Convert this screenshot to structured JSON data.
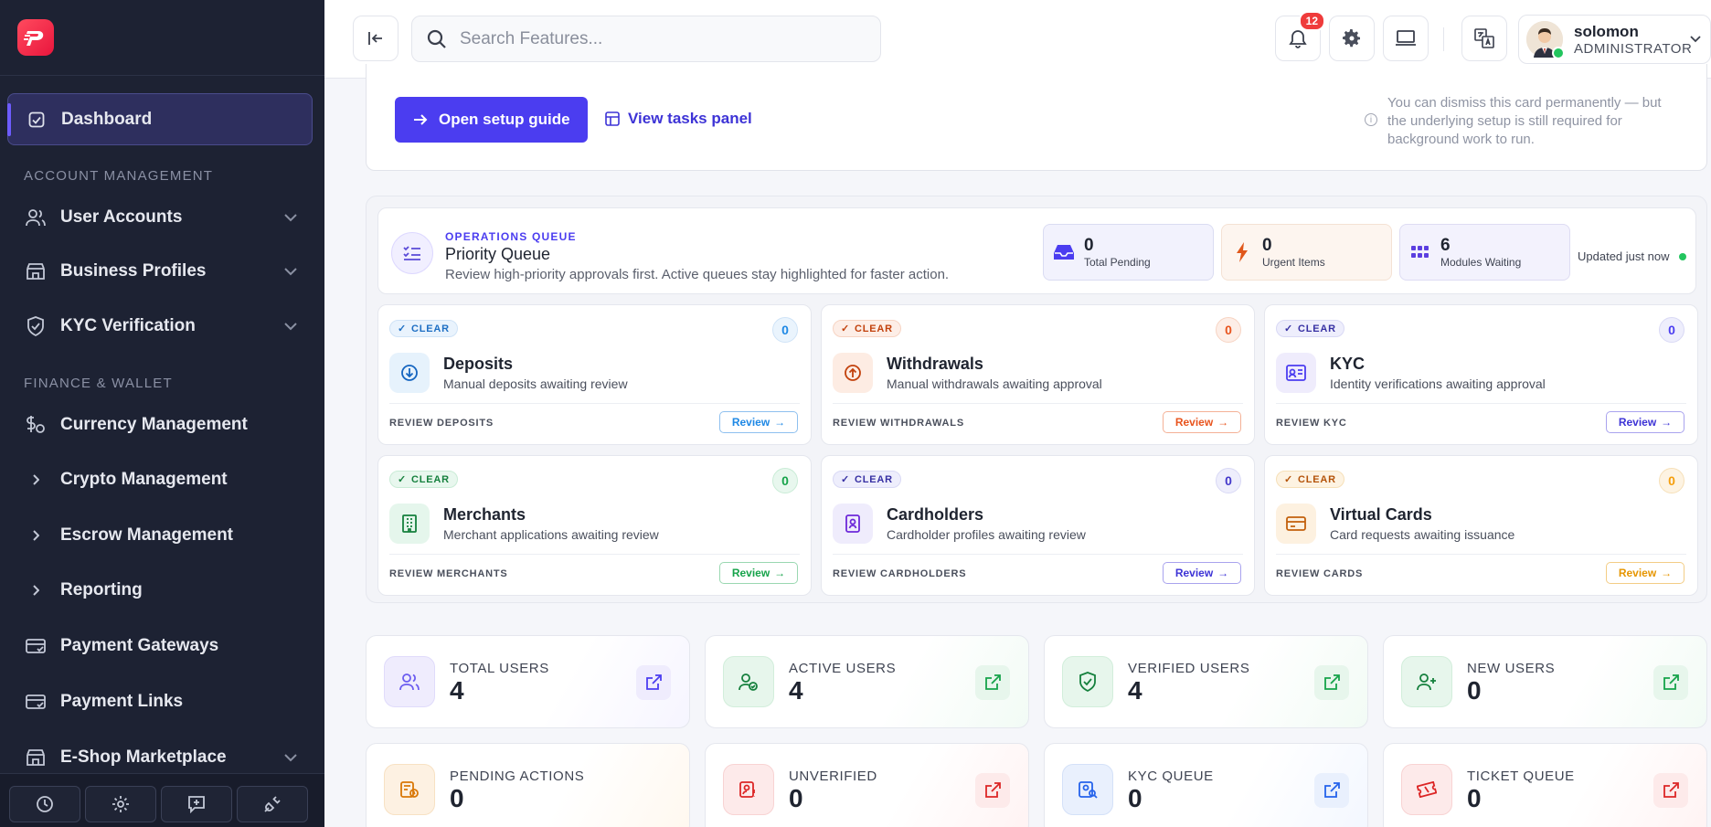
{
  "sidebar": {
    "logo_icon": "brand-logo-icon",
    "active_item": {
      "label": "Dashboard",
      "icon": "dashboard-check-icon"
    },
    "sections": [
      {
        "label": "ACCOUNT MANAGEMENT"
      },
      {
        "label": "FINANCE & WALLET"
      }
    ],
    "items": [
      {
        "label": "User Accounts",
        "icon": "users-icon",
        "has_chevron": true
      },
      {
        "label": "Business Profiles",
        "icon": "store-icon",
        "has_chevron": true
      },
      {
        "label": "KYC Verification",
        "icon": "shield-check-icon",
        "has_chevron": true
      },
      {
        "label": "Currency Management",
        "icon": "currency-icon",
        "has_chevron": false
      },
      {
        "label": "Crypto Management",
        "icon": "chevron-right-icon",
        "has_chevron": false
      },
      {
        "label": "Escrow Management",
        "icon": "chevron-right-icon",
        "has_chevron": false
      },
      {
        "label": "Reporting",
        "icon": "chevron-right-icon",
        "has_chevron": false
      },
      {
        "label": "Payment Gateways",
        "icon": "card-icon",
        "has_chevron": false
      },
      {
        "label": "Payment Links",
        "icon": "card-icon",
        "has_chevron": false
      },
      {
        "label": "E-Shop Marketplace",
        "icon": "store-icon",
        "has_chevron": true
      }
    ],
    "bottom_buttons": [
      "history-icon",
      "settings-icon",
      "feedback-icon",
      "unplug-icon"
    ]
  },
  "header": {
    "search_placeholder": "Search Features...",
    "notification_count": "12",
    "user": {
      "name": "solomon",
      "role": "ADMINISTRATOR"
    }
  },
  "setup": {
    "primary_button": "Open setup guide",
    "link_button": "View tasks panel",
    "note": "You can dismiss this card permanently — but the underlying setup is still required for background work to run."
  },
  "queue": {
    "kicker": "OPERATIONS QUEUE",
    "title": "Priority Queue",
    "subtitle": "Review high-priority approvals first. Active queues stay highlighted for faster action.",
    "stats": [
      {
        "value": "0",
        "label": "Total Pending"
      },
      {
        "value": "0",
        "label": "Urgent Items"
      },
      {
        "value": "6",
        "label": "Modules Waiting"
      }
    ],
    "updated": "Updated just now",
    "cards": [
      {
        "status": "CLEAR",
        "count": "0",
        "title": "Deposits",
        "subtitle": "Manual deposits awaiting review",
        "footer": "REVIEW DEPOSITS",
        "button": "Review",
        "color": "#1e88e5"
      },
      {
        "status": "CLEAR",
        "count": "0",
        "title": "Withdrawals",
        "subtitle": "Manual withdrawals awaiting approval",
        "footer": "REVIEW WITHDRAWALS",
        "button": "Review",
        "color": "#e8541e"
      },
      {
        "status": "CLEAR",
        "count": "0",
        "title": "KYC",
        "subtitle": "Identity verifications awaiting approval",
        "footer": "REVIEW KYC",
        "button": "Review",
        "color": "#4b3df0"
      },
      {
        "status": "CLEAR",
        "count": "0",
        "title": "Merchants",
        "subtitle": "Merchant applications awaiting review",
        "footer": "REVIEW MERCHANTS",
        "button": "Review",
        "color": "#16a34a"
      },
      {
        "status": "CLEAR",
        "count": "0",
        "title": "Cardholders",
        "subtitle": "Cardholder profiles awaiting review",
        "footer": "REVIEW CARDHOLDERS",
        "button": "Review",
        "color": "#4338ca"
      },
      {
        "status": "CLEAR",
        "count": "0",
        "title": "Virtual Cards",
        "subtitle": "Card requests awaiting issuance",
        "footer": "REVIEW CARDS",
        "button": "Review",
        "color": "#f59e0b"
      }
    ]
  },
  "metrics": [
    {
      "label": "TOTAL USERS",
      "value": "4",
      "icon": "users-icon",
      "color": "#6b5cf0"
    },
    {
      "label": "ACTIVE USERS",
      "value": "4",
      "icon": "user-check-icon",
      "color": "#16a34a"
    },
    {
      "label": "VERIFIED USERS",
      "value": "4",
      "icon": "shield-check-icon",
      "color": "#16a34a"
    },
    {
      "label": "NEW USERS",
      "value": "0",
      "icon": "user-plus-icon",
      "color": "#16a34a"
    },
    {
      "label": "PENDING ACTIONS",
      "value": "0",
      "icon": "pending-icon",
      "color": "#ea8a1a"
    },
    {
      "label": "UNVERIFIED",
      "value": "0",
      "icon": "id-alert-icon",
      "color": "#dc2626"
    },
    {
      "label": "KYC QUEUE",
      "value": "0",
      "icon": "kyc-search-icon",
      "color": "#2563eb"
    },
    {
      "label": "TICKET QUEUE",
      "value": "0",
      "icon": "ticket-icon",
      "color": "#dc2626"
    }
  ]
}
